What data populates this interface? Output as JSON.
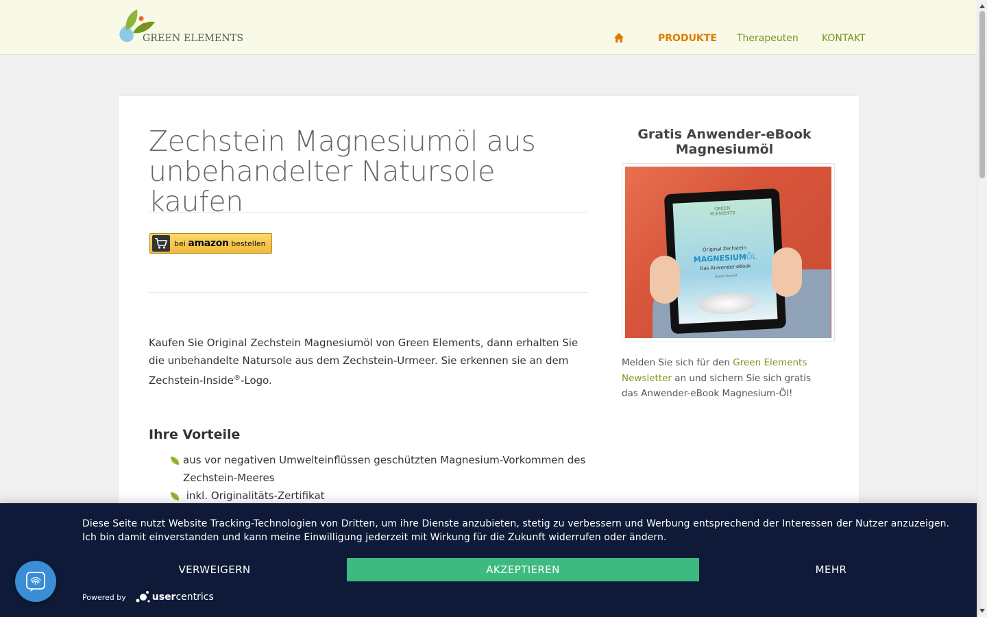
{
  "header": {
    "logo_text": "GREEN ELEMENTS",
    "nav": {
      "home_icon": "home-icon",
      "produkte": "PRODUKTE",
      "therapeuten": "Therapeuten",
      "kontakt": "KONTAKT"
    }
  },
  "main": {
    "title_line1": "Zechstein Magnesiumöl aus",
    "title_line2": "unbehandelter Natursole kaufen",
    "amazon_button": {
      "prefix": "bei",
      "brand": "amazon",
      "suffix": "bestellen"
    },
    "intro_part1": "Kaufen Sie Original Zechstein Magnesiumöl von Green Elements, dann erhalten Sie die unbehandelte Natursole aus dem Zechstein-Urmeer. Sie erkennen sie an dem Zechstein-Inside",
    "intro_reg": "®",
    "intro_part2": "-Logo.",
    "benefits_heading": "Ihre Vorteile",
    "benefits": [
      "aus vor negativen Umwelteinflüssen geschützten Magnesium-Vorkommen des Zechstein-Meeres",
      " inkl. Originalitäts-Zertifikat"
    ]
  },
  "sidebar": {
    "title_line1": "Gratis Anwender-eBook",
    "title_line2": "Magnesiumöl",
    "ebook_cover": {
      "brand_line1": "GREEN",
      "brand_line2": "ELEMENTS",
      "line1": "Original Zechstein",
      "line2_a": "MAGNESIUM",
      "line2_b": "ÖL",
      "line3": "Das Anwender-eBook",
      "author": "Daniel Dewald"
    },
    "text_before": "Melden Sie sich für den ",
    "link_text": "Green Elements Newsletter",
    "text_after": " an und sichern Sie sich gratis das Anwender-eBook Magnesium-Öl!"
  },
  "cookie_banner": {
    "text": "Diese Seite nutzt Website Tracking-Technologien von Dritten, um ihre Dienste anzubieten, stetig zu verbessern und Werbung entsprechend der Interessen der Nutzer anzuzeigen. Ich bin damit einverstanden und kann meine Einwilligung jederzeit mit Wirkung für die Zukunft widerrufen oder ändern.",
    "deny": "VERWEIGERN",
    "accept": "AKZEPTIEREN",
    "more": "MEHR",
    "powered_by": "Powered by",
    "uc_brand_a": "user",
    "uc_brand_b": "centrics"
  },
  "colors": {
    "accent_orange": "#e07b00",
    "accent_green": "#7a9a1a",
    "banner_bg": "#0e1a38",
    "accept_green": "#3dba7f",
    "fingerprint_blue": "#3a8ed6"
  }
}
